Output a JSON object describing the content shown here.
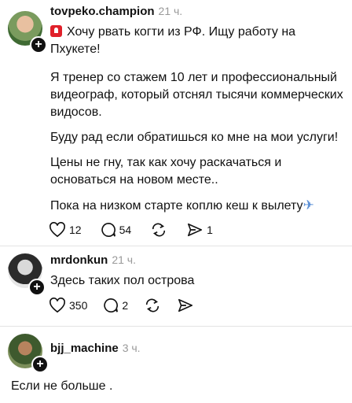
{
  "posts": [
    {
      "username": "tovpeko.champion",
      "time": "21 ч.",
      "icon": "siren-icon",
      "paragraphs": [
        [
          "Хочу рвать когти из РФ. Ищу работу на",
          "Пхукете!"
        ],
        [
          "Я тренер со стажем 10 лет и профессиональный",
          "видеограф, который отснял тысячи коммерческих",
          "видосов."
        ],
        [
          "Буду рад если обратишься ко мне на мои услуги!"
        ],
        [
          "Цены не гну, так как хочу раскачаться и",
          "основаться на новом месте.."
        ],
        [
          "Пока на низком старте коплю кеш к вылету"
        ]
      ],
      "trailing_icon": "airplane-icon",
      "likes": "12",
      "replies": "54",
      "reposts": "",
      "shares": "1"
    },
    {
      "username": "mrdonkun",
      "time": "21 ч.",
      "text": "Здесь таких пол острова",
      "likes": "350",
      "replies": "2",
      "reposts": "",
      "shares": ""
    },
    {
      "username": "bjj_machine",
      "time": "3 ч.",
      "text": "Если не больше ."
    }
  ],
  "colors": {
    "text": "#111111",
    "muted": "#999999",
    "divider": "#e3e3e3",
    "badge": "#111111"
  }
}
